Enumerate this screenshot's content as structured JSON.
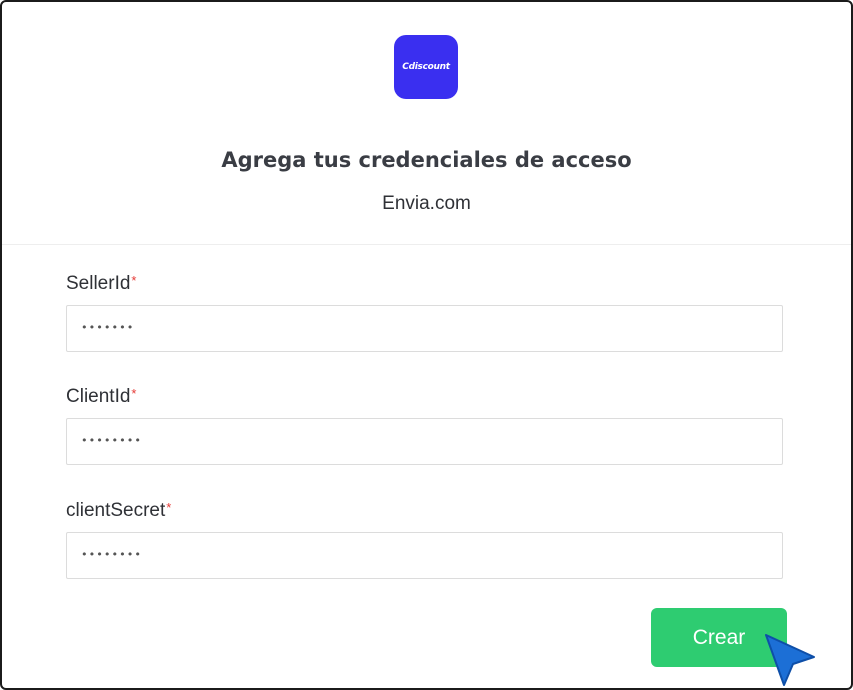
{
  "header": {
    "logo_text": "Cdiscount",
    "title": "Agrega tus credenciales de acceso",
    "subtitle": "Envia.com"
  },
  "form": {
    "required_mark": "*",
    "fields": [
      {
        "label": "SellerId",
        "value": "•••••••"
      },
      {
        "label": "ClientId",
        "value": "••••••••"
      },
      {
        "label": "clientSecret",
        "value": "••••••••"
      }
    ],
    "submit_label": "Crear"
  },
  "colors": {
    "logo_bg": "#3a2ff0",
    "button_bg": "#2ecc71",
    "required": "#e53935",
    "cursor": "#1c6fd6"
  },
  "icons": {
    "cursor": "pointer-arrow-icon"
  }
}
